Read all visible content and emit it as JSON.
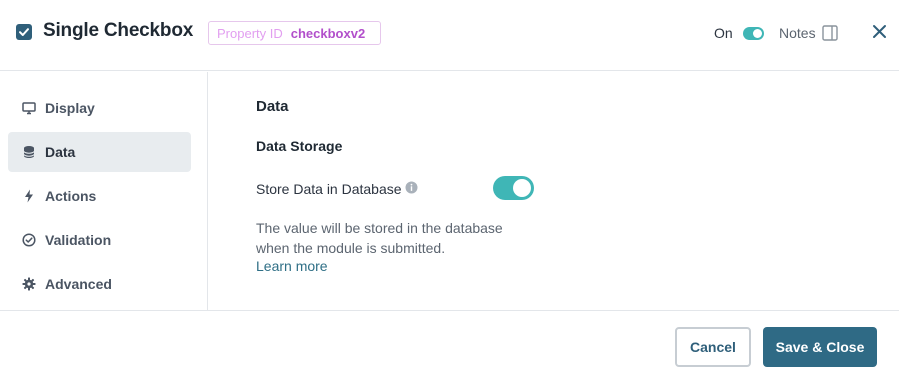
{
  "header": {
    "title": "Single Checkbox",
    "property_id_label": "Property ID",
    "property_id_value": "checkboxv2",
    "on_label": "On",
    "on_toggle_state": true,
    "notes_label": "Notes"
  },
  "sidebar": {
    "items": [
      {
        "label": "Display",
        "icon": "monitor-icon",
        "active": false
      },
      {
        "label": "Data",
        "icon": "database-icon",
        "active": true
      },
      {
        "label": "Actions",
        "icon": "lightning-icon",
        "active": false
      },
      {
        "label": "Validation",
        "icon": "check-circle-icon",
        "active": false
      },
      {
        "label": "Advanced",
        "icon": "gear-icon",
        "active": false
      }
    ]
  },
  "main": {
    "section_title": "Data",
    "subsection_title": "Data Storage",
    "store_label": "Store Data in Database",
    "store_toggle_state": true,
    "help_text": "The value will be stored in the database when the module is submitted.",
    "learn_more": "Learn more"
  },
  "footer": {
    "cancel_label": "Cancel",
    "save_label": "Save & Close"
  },
  "colors": {
    "accent_teal": "#3fb6b6",
    "primary_button": "#2f6a85",
    "property_id_border": "#e6c7ec"
  }
}
